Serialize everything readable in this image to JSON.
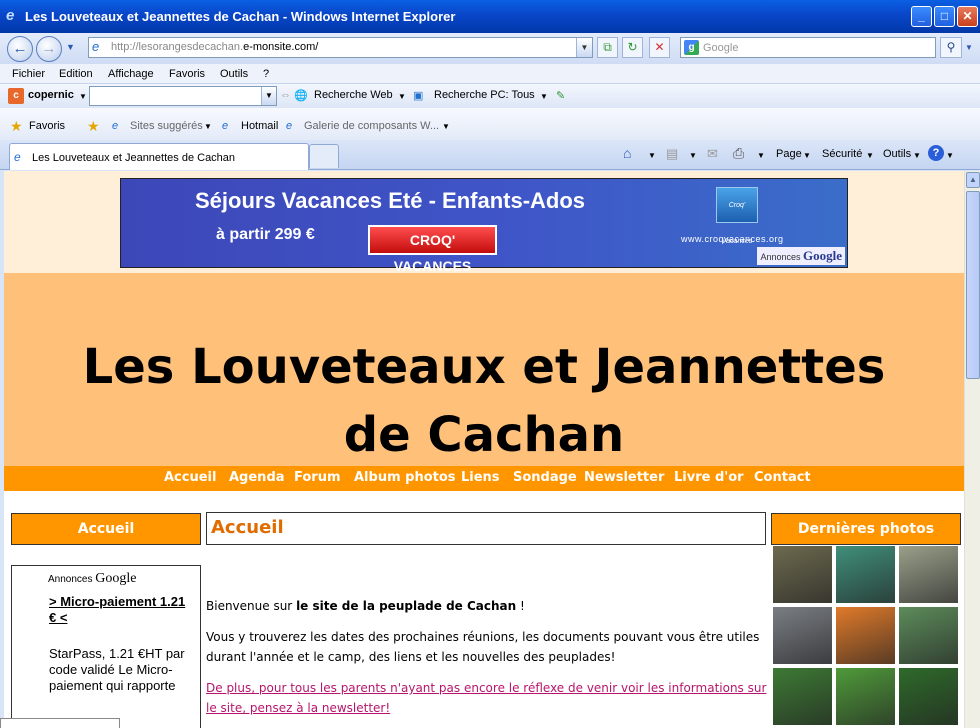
{
  "window": {
    "title": "Les Louveteaux et Jeannettes de Cachan - Windows Internet Explorer"
  },
  "address": {
    "url_prefix": "http://lesorangesdecachan.",
    "url_domain": "e-monsite.com/"
  },
  "search": {
    "placeholder": "Google"
  },
  "menu": [
    "Fichier",
    "Edition",
    "Affichage",
    "Favoris",
    "Outils",
    "?"
  ],
  "copernic": {
    "brand": "copernic",
    "web_search": "Recherche Web",
    "pc_search": "Recherche PC: Tous"
  },
  "favorites": {
    "favoris": "Favoris",
    "suggested": "Sites suggérés",
    "hotmail": "Hotmail",
    "gallery": "Galerie de composants W..."
  },
  "tab": {
    "title": "Les Louveteaux et Jeannettes de Cachan"
  },
  "commands": {
    "page": "Page",
    "security": "Sécurité",
    "tools": "Outils"
  },
  "ad_banner": {
    "headline": "Séjours Vacances Eté - Enfants-Ados",
    "price": "à partir 299 €",
    "button": "CROQ' VACANCES",
    "logo": "Croq' Vacances",
    "url": "www.croqvacances.org",
    "annonces": "Annonces",
    "google": "Google"
  },
  "site": {
    "title": "Les Louveteaux et Jeannettes de Cachan",
    "nav": [
      "Accueil",
      "Agenda",
      "Forum",
      "Album photos",
      "Liens",
      "Sondage",
      "Newsletter",
      "Livre d'or",
      "Contact"
    ],
    "left_heading": "Accueil",
    "main_heading": "Accueil",
    "right_heading": "Dernières photos"
  },
  "left_ad": {
    "annonces": "Annonces",
    "google": "Google",
    "title": "> Micro-paiement 1.21 € <",
    "desc": "StarPass, 1.21 €HT par code validé Le Micro-paiement qui rapporte"
  },
  "content": {
    "p1_a": "Bienvenue sur ",
    "p1_b": "le site de la peuplade de Cachan",
    "p1_c": " !",
    "p2": "Vous y trouverez les dates des prochaines réunions, les documents pouvant vous être utiles durant l'année et le camp, des liens et les nouvelles des peuplades!",
    "p3": "De plus, pour tous les parents n'ayant pas encore le réflexe de venir voir les informations sur le site, pensez à la newsletter!"
  },
  "photo_colors": [
    "#6d6a4e",
    "#3f8f7a",
    "#9aa08a",
    "#7a7e84",
    "#e07a2a",
    "#5c8c5a",
    "#3d7a34",
    "#4f9a3a",
    "#2e6a2a"
  ]
}
